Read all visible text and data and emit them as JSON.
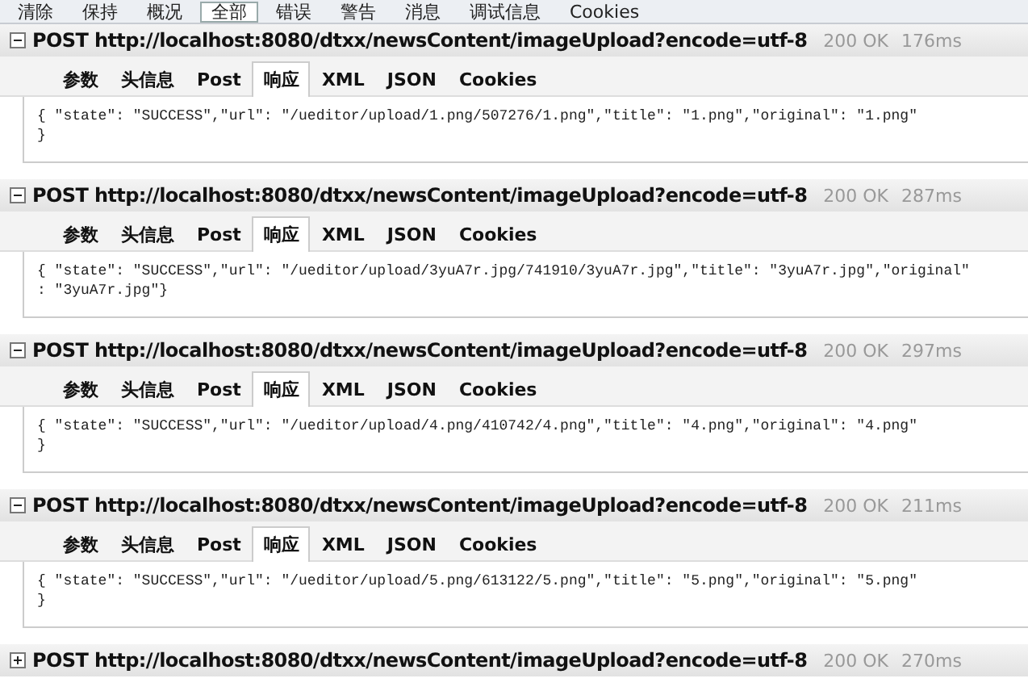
{
  "toolbar": [
    {
      "label": "清除",
      "selected": false
    },
    {
      "label": "保持",
      "selected": false
    },
    {
      "label": "概况",
      "selected": false
    },
    {
      "label": "全部",
      "selected": true
    },
    {
      "label": "错误",
      "selected": false
    },
    {
      "label": "警告",
      "selected": false
    },
    {
      "label": "消息",
      "selected": false
    },
    {
      "label": "调试信息",
      "selected": false
    },
    {
      "label": "Cookies",
      "selected": false
    }
  ],
  "requests": [
    {
      "title": "POST http://localhost:8080/dtxx/newsContent/imageUpload?encode=utf-8",
      "status": "200 OK",
      "time": "176ms",
      "expanded": true,
      "tabs": [
        {
          "label": "参数",
          "selected": false
        },
        {
          "label": "头信息",
          "selected": false
        },
        {
          "label": "Post",
          "selected": false
        },
        {
          "label": "响应",
          "selected": true
        },
        {
          "label": "XML",
          "selected": false
        },
        {
          "label": "JSON",
          "selected": false
        },
        {
          "label": "Cookies",
          "selected": false
        }
      ],
      "body": [
        "{ \"state\": \"SUCCESS\",\"url\": \"/ueditor/upload/1.png/507276/1.png\",\"title\": \"1.png\",\"original\": \"1.png\"",
        "}"
      ]
    },
    {
      "title": "POST http://localhost:8080/dtxx/newsContent/imageUpload?encode=utf-8",
      "status": "200 OK",
      "time": "287ms",
      "expanded": true,
      "tabs": [
        {
          "label": "参数",
          "selected": false
        },
        {
          "label": "头信息",
          "selected": false
        },
        {
          "label": "Post",
          "selected": false
        },
        {
          "label": "响应",
          "selected": true
        },
        {
          "label": "XML",
          "selected": false
        },
        {
          "label": "JSON",
          "selected": false
        },
        {
          "label": "Cookies",
          "selected": false
        }
      ],
      "body": [
        "{ \"state\": \"SUCCESS\",\"url\": \"/ueditor/upload/3yuA7r.jpg/741910/3yuA7r.jpg\",\"title\": \"3yuA7r.jpg\",\"original\"",
        ": \"3yuA7r.jpg\"}"
      ]
    },
    {
      "title": "POST http://localhost:8080/dtxx/newsContent/imageUpload?encode=utf-8",
      "status": "200 OK",
      "time": "297ms",
      "expanded": true,
      "tabs": [
        {
          "label": "参数",
          "selected": false
        },
        {
          "label": "头信息",
          "selected": false
        },
        {
          "label": "Post",
          "selected": false
        },
        {
          "label": "响应",
          "selected": true
        },
        {
          "label": "XML",
          "selected": false
        },
        {
          "label": "JSON",
          "selected": false
        },
        {
          "label": "Cookies",
          "selected": false
        }
      ],
      "body": [
        "{ \"state\": \"SUCCESS\",\"url\": \"/ueditor/upload/4.png/410742/4.png\",\"title\": \"4.png\",\"original\": \"4.png\"",
        "}"
      ]
    },
    {
      "title": "POST http://localhost:8080/dtxx/newsContent/imageUpload?encode=utf-8",
      "status": "200 OK",
      "time": "211ms",
      "expanded": true,
      "tabs": [
        {
          "label": "参数",
          "selected": false
        },
        {
          "label": "头信息",
          "selected": false
        },
        {
          "label": "Post",
          "selected": false
        },
        {
          "label": "响应",
          "selected": true
        },
        {
          "label": "XML",
          "selected": false
        },
        {
          "label": "JSON",
          "selected": false
        },
        {
          "label": "Cookies",
          "selected": false
        }
      ],
      "body": [
        "{ \"state\": \"SUCCESS\",\"url\": \"/ueditor/upload/5.png/613122/5.png\",\"title\": \"5.png\",\"original\": \"5.png\"",
        "}"
      ]
    },
    {
      "title": "POST http://localhost:8080/dtxx/newsContent/imageUpload?encode=utf-8",
      "status": "200 OK",
      "time": "270ms",
      "expanded": false
    }
  ]
}
